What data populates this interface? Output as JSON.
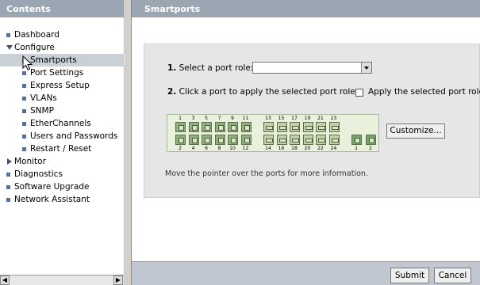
{
  "sidebar": {
    "title": "Contents",
    "items": [
      {
        "label": "Dashboard",
        "marker": "square"
      },
      {
        "label": "Configure",
        "marker": "expanded"
      },
      {
        "label": "Smartports",
        "marker": "square",
        "selected": true
      },
      {
        "label": "Port Settings",
        "marker": "square"
      },
      {
        "label": "Express Setup",
        "marker": "square"
      },
      {
        "label": "VLANs",
        "marker": "square"
      },
      {
        "label": "SNMP",
        "marker": "square"
      },
      {
        "label": "EtherChannels",
        "marker": "square"
      },
      {
        "label": "Users and Passwords",
        "marker": "square"
      },
      {
        "label": "Restart / Reset",
        "marker": "square"
      },
      {
        "label": "Monitor",
        "marker": "collapsed"
      },
      {
        "label": "Diagnostics",
        "marker": "square"
      },
      {
        "label": "Software Upgrade",
        "marker": "square"
      },
      {
        "label": "Network Assistant",
        "marker": "square"
      }
    ]
  },
  "main": {
    "title": "Smartports",
    "step1_num": "1.",
    "step1_text": "Select a port role:",
    "port_role_value": "",
    "step2_num": "2.",
    "step2_text": "Click a port to apply the selected port role.",
    "apply_label": "Apply the selected port role",
    "top_port_numbers": [
      "1",
      "3",
      "5",
      "7",
      "9",
      "11",
      "13",
      "15",
      "17",
      "19",
      "21",
      "23"
    ],
    "bottom_port_numbers": [
      "2",
      "4",
      "6",
      "8",
      "10",
      "12",
      "14",
      "16",
      "18",
      "20",
      "22",
      "24"
    ],
    "uplink_numbers": [
      "1",
      "2"
    ],
    "customize_label": "Customize...",
    "hint": "Move the pointer over the ports for more information."
  },
  "footer": {
    "submit_label": "Submit",
    "cancel_label": "Cancel"
  },
  "colors": {
    "header_bg": "#9aa7b3",
    "selected_bg": "#c9d0d6",
    "switch_bg": "#e9f0dc"
  }
}
